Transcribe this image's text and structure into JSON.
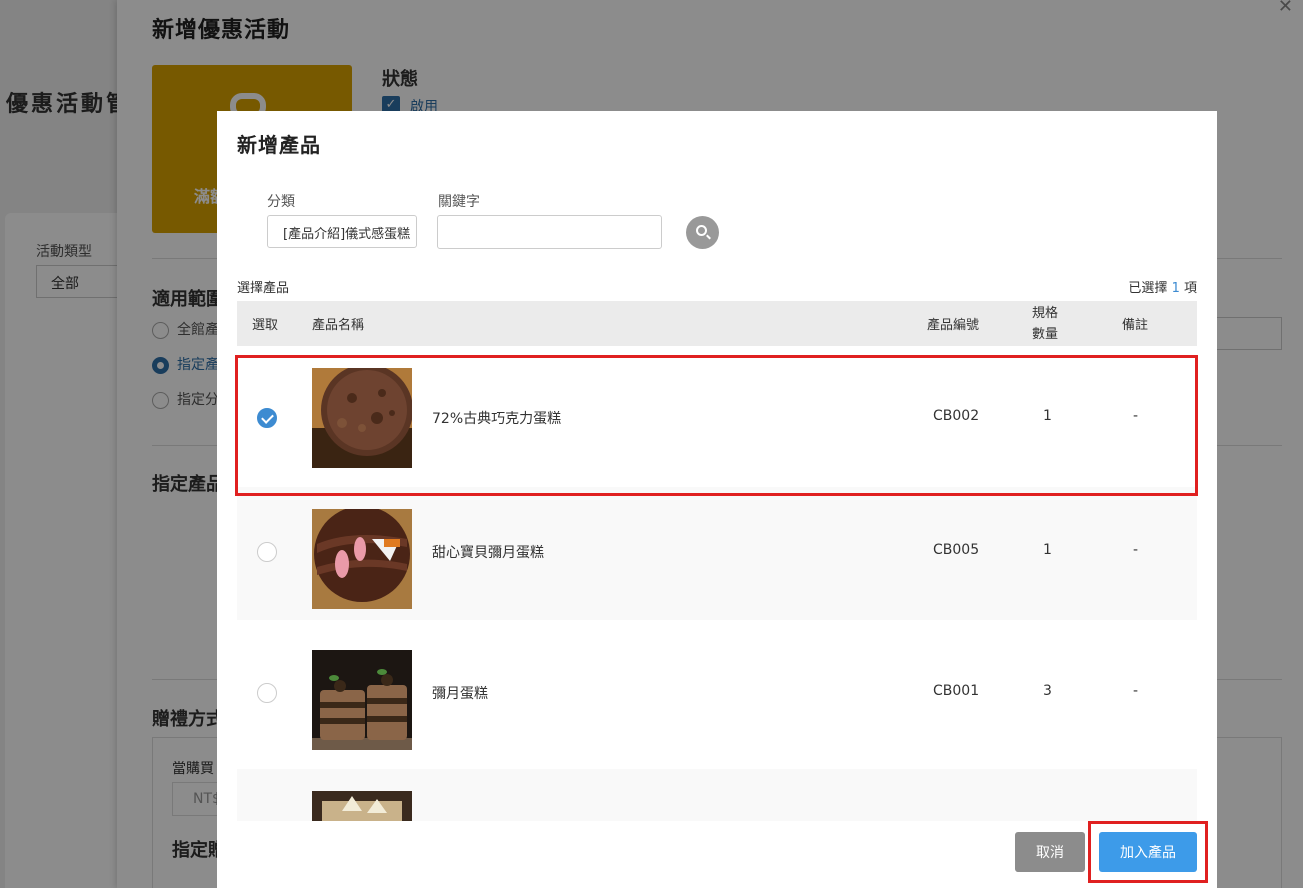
{
  "background": {
    "page_title": "優惠活動管理",
    "filter_label": "活動類型",
    "filter_value": "全部"
  },
  "drawer": {
    "title": "新增優惠活動",
    "promo_card_text": "滿額",
    "status_title": "狀態",
    "status_option": "啟用",
    "scope_title": "適用範圍",
    "scope_options": [
      "全館產品",
      "指定產品",
      "指定分類"
    ],
    "specified_title": "指定產品",
    "gift_title": "贈禮方式",
    "gift_label": "當購買",
    "gift_input": "NT$",
    "gift_sub": "指定贈品"
  },
  "modal": {
    "title": "新增產品",
    "category_label": "分類",
    "category_value": "[產品介紹]儀式感蛋糕",
    "keyword_label": "關鍵字",
    "keyword_value": "",
    "select_products_label": "選擇產品",
    "selected_prefix": "已選擇",
    "selected_count": "1",
    "selected_suffix": "項",
    "columns": {
      "select": "選取",
      "name": "產品名稱",
      "code": "產品編號",
      "spec_line1": "規格",
      "spec_line2": "數量",
      "note": "備註"
    },
    "products": [
      {
        "name": "72%古典巧克力蛋糕",
        "code": "CB002",
        "qty": "1",
        "note": "-",
        "selected": true
      },
      {
        "name": "甜心寶貝彌月蛋糕",
        "code": "CB005",
        "qty": "1",
        "note": "-",
        "selected": false
      },
      {
        "name": "彌月蛋糕",
        "code": "CB001",
        "qty": "3",
        "note": "-",
        "selected": false
      },
      {
        "name": "",
        "code": "",
        "qty": "",
        "note": "",
        "selected": false
      }
    ],
    "cancel_label": "取消",
    "add_label": "加入產品"
  },
  "colors": {
    "accent": "#3d8bd1",
    "primary_button": "#3d9be9",
    "highlight": "#e02020",
    "promo_card": "#d9a200"
  }
}
